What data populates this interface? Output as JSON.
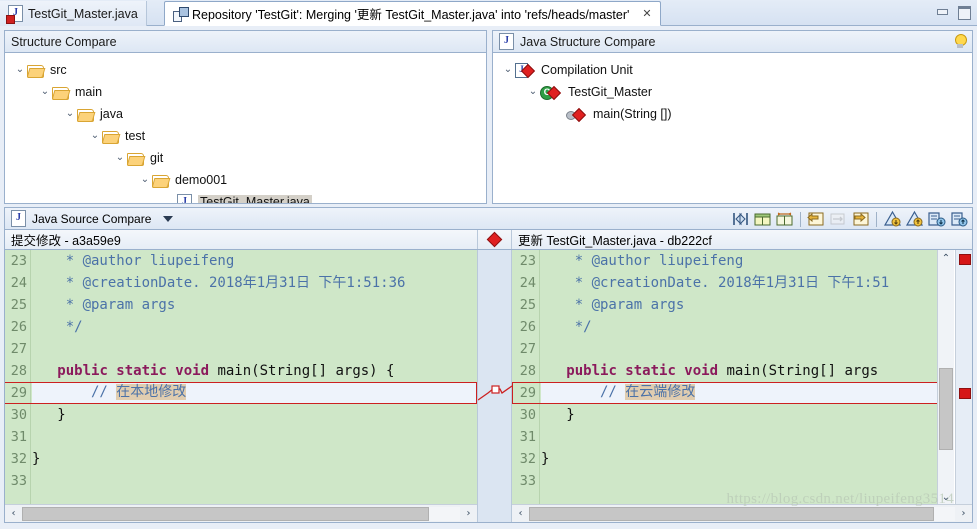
{
  "window": {
    "minimize_label": "Minimize",
    "maximize_label": "Maximize"
  },
  "tabs": [
    {
      "label": "TestGit_Master.java",
      "icon": "java-file-error-icon",
      "active": false
    },
    {
      "label": "Repository 'TestGit': Merging '更新 TestGit_Master.java' into 'refs/heads/master'",
      "icon": "repository-icon",
      "active": true,
      "close": "✕"
    }
  ],
  "structure_compare": {
    "title": "Structure Compare",
    "tree": [
      {
        "label": "src",
        "depth": 0,
        "twisty": "⌄",
        "icon": "folder-icon",
        "selected": false
      },
      {
        "label": "main",
        "depth": 1,
        "twisty": "⌄",
        "icon": "folder-icon",
        "selected": false
      },
      {
        "label": "java",
        "depth": 2,
        "twisty": "⌄",
        "icon": "folder-icon",
        "selected": false
      },
      {
        "label": "test",
        "depth": 3,
        "twisty": "⌄",
        "icon": "folder-icon",
        "selected": false
      },
      {
        "label": "git",
        "depth": 4,
        "twisty": "⌄",
        "icon": "folder-icon",
        "selected": false
      },
      {
        "label": "demo001",
        "depth": 5,
        "twisty": "⌄",
        "icon": "folder-icon",
        "selected": false
      },
      {
        "label": "TestGit_Master.java",
        "depth": 6,
        "twisty": "",
        "icon": "java-file-icon",
        "selected": true
      }
    ]
  },
  "java_structure_compare": {
    "title": "Java Structure Compare",
    "hint_icon": "lightbulb-icon",
    "tree": [
      {
        "label": "Compilation Unit",
        "depth": 0,
        "twisty": "⌄",
        "icon": "compilation-unit-icon",
        "change": true
      },
      {
        "label": "TestGit_Master",
        "depth": 1,
        "twisty": "⌄",
        "icon": "class-icon",
        "change": true
      },
      {
        "label": "main(String [])",
        "depth": 2,
        "twisty": "",
        "icon": "method-icon",
        "change": true
      }
    ]
  },
  "source_compare": {
    "title": "Java Source Compare",
    "menu_icon": "view-menu-chevron-icon",
    "toolbar": [
      {
        "name": "switch-left-right-icon",
        "tooltip": "Switch Left and Right View"
      },
      {
        "name": "two-pane-layout-icon",
        "tooltip": "Show Ancestor Pane"
      },
      {
        "name": "ignore-whitespace-icon",
        "tooltip": "Ignore White Space"
      },
      {
        "name": "copy-all-left-to-right-icon",
        "tooltip": "Copy All from Left to Right"
      },
      {
        "name": "copy-current-change-icon",
        "tooltip": "Copy Current Change",
        "disabled": true
      },
      {
        "name": "copy-all-right-to-left-icon",
        "tooltip": "Copy All from Right to Left"
      },
      {
        "name": "next-difference-icon",
        "tooltip": "Next Difference"
      },
      {
        "name": "previous-difference-icon",
        "tooltip": "Previous Difference"
      },
      {
        "name": "next-change-icon",
        "tooltip": "Next Change"
      },
      {
        "name": "previous-change-icon",
        "tooltip": "Previous Change"
      }
    ],
    "left_header": "提交修改 - a3a59e9",
    "right_header": "更新 TestGit_Master.java - db222cf",
    "center_marker_icon": "change-diamond-icon",
    "left_lines": [
      {
        "num": "23",
        "segments": [
          {
            "t": "    * @author liupeifeng",
            "c": "cmt"
          }
        ]
      },
      {
        "num": "24",
        "segments": [
          {
            "t": "    * @creationDate. 2018年1月31日 下午1:51:36",
            "c": "cmt"
          }
        ]
      },
      {
        "num": "25",
        "segments": [
          {
            "t": "    * @param args",
            "c": "cmt"
          }
        ]
      },
      {
        "num": "26",
        "segments": [
          {
            "t": "    */",
            "c": "cmt"
          }
        ]
      },
      {
        "num": "27",
        "segments": [
          {
            "t": "",
            "c": ""
          }
        ]
      },
      {
        "num": "28",
        "segments": [
          {
            "t": "   ",
            "c": ""
          },
          {
            "t": "public static void ",
            "c": "kw"
          },
          {
            "t": "main(String[] args) {",
            "c": ""
          }
        ]
      },
      {
        "num": "29",
        "segments": [
          {
            "t": "       // ",
            "c": "cmt"
          },
          {
            "t": "在本地修改",
            "c": "cmt chg"
          }
        ],
        "highlight": true
      },
      {
        "num": "30",
        "segments": [
          {
            "t": "   }",
            "c": ""
          }
        ]
      },
      {
        "num": "31",
        "segments": [
          {
            "t": "",
            "c": ""
          }
        ]
      },
      {
        "num": "32",
        "segments": [
          {
            "t": "}",
            "c": ""
          }
        ]
      },
      {
        "num": "33",
        "segments": [
          {
            "t": "",
            "c": ""
          }
        ]
      }
    ],
    "right_lines": [
      {
        "num": "23",
        "segments": [
          {
            "t": "    * @author liupeifeng",
            "c": "cmt"
          }
        ]
      },
      {
        "num": "24",
        "segments": [
          {
            "t": "    * @creationDate. 2018年1月31日 下午1:51",
            "c": "cmt"
          }
        ]
      },
      {
        "num": "25",
        "segments": [
          {
            "t": "    * @param args",
            "c": "cmt"
          }
        ]
      },
      {
        "num": "26",
        "segments": [
          {
            "t": "    */",
            "c": "cmt"
          }
        ]
      },
      {
        "num": "27",
        "segments": [
          {
            "t": "",
            "c": ""
          }
        ]
      },
      {
        "num": "28",
        "segments": [
          {
            "t": "   ",
            "c": ""
          },
          {
            "t": "public static void ",
            "c": "kw"
          },
          {
            "t": "main(String[] args",
            "c": ""
          }
        ]
      },
      {
        "num": "29",
        "segments": [
          {
            "t": "       // ",
            "c": "cmt"
          },
          {
            "t": "在云端修改",
            "c": "cmt chg"
          }
        ],
        "highlight": true
      },
      {
        "num": "30",
        "segments": [
          {
            "t": "   }",
            "c": ""
          }
        ]
      },
      {
        "num": "31",
        "segments": [
          {
            "t": "",
            "c": ""
          }
        ]
      },
      {
        "num": "32",
        "segments": [
          {
            "t": "}",
            "c": ""
          }
        ]
      },
      {
        "num": "33",
        "segments": [
          {
            "t": "",
            "c": ""
          }
        ]
      }
    ],
    "scroll": {
      "left_arrow": "‹",
      "right_arrow": "›",
      "up_arrow": "⌃",
      "down_arrow": "⌄"
    }
  },
  "watermark": "https://blog.csdn.net/liupeifeng3514",
  "colors": {
    "diff_background": "#cfe7c8",
    "change_highlight": "#e0cdb0",
    "selection_border": "#cc2020",
    "panel_header": "#dde7f4"
  }
}
